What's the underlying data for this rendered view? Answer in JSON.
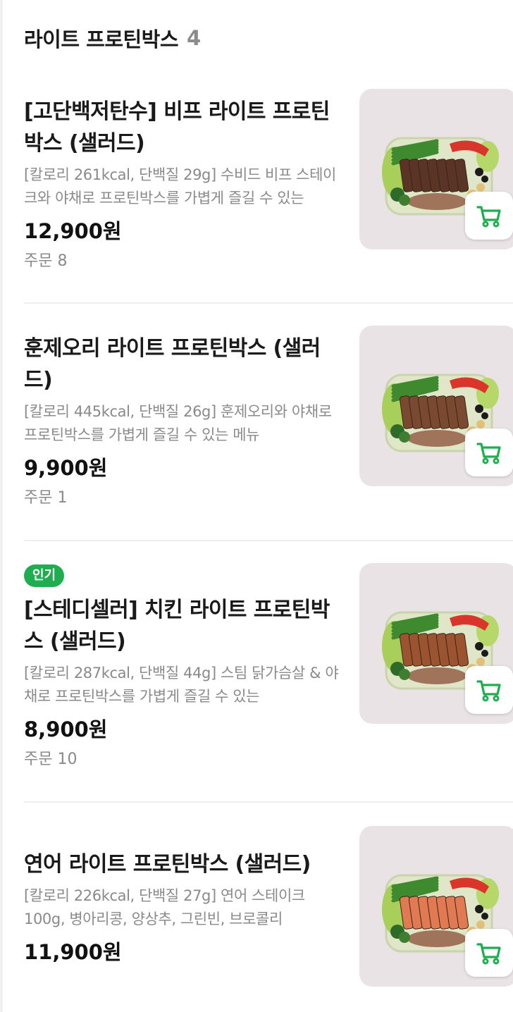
{
  "section": {
    "title": "라이트 프로틴박스",
    "count": "4"
  },
  "items": [
    {
      "badge": "",
      "name": "[고단백저탄수] 비프 라이트 프로틴박스 (샐러드)",
      "desc": "[칼로리 261kcal, 단백질 29g] 수비드 비프 스테이크와 야채로 프로틴박스를 가볍게 즐길 수 있는",
      "price": "12,900원",
      "orders": "주문 8",
      "meat": "beef"
    },
    {
      "badge": "",
      "name": "훈제오리 라이트 프로틴박스 (샐러드)",
      "desc": "[칼로리 445kcal, 단백질 26g] 훈제오리와 야채로 프로틴박스를 가볍게 즐길 수 있는 메뉴",
      "price": "9,900원",
      "orders": "주문 1",
      "meat": "duck"
    },
    {
      "badge": "인기",
      "name": "[스테디셀러] 치킨 라이트 프로틴박스 (샐러드)",
      "desc": "[칼로리 287kcal, 단백질 44g] 스팀 닭가슴살 & 야채로 프로틴박스를 가볍게 즐길 수 있는",
      "price": "8,900원",
      "orders": "주문 10",
      "meat": "chicken"
    },
    {
      "badge": "",
      "name": "연어 라이트 프로틴박스 (샐러드)",
      "desc": "[칼로리 226kcal, 단백질 27g] 연어 스테이크 100g, 병아리콩, 양상추, 그린빈, 브로콜리",
      "price": "11,900원",
      "orders": "",
      "meat": "salmon"
    }
  ],
  "colors": {
    "accent": "#1fae4f",
    "beef": "#5a3526",
    "duck": "#7a4a30",
    "chicken": "#9a5530",
    "salmon": "#e07a52"
  },
  "icons": {
    "cart": "cart-icon"
  }
}
